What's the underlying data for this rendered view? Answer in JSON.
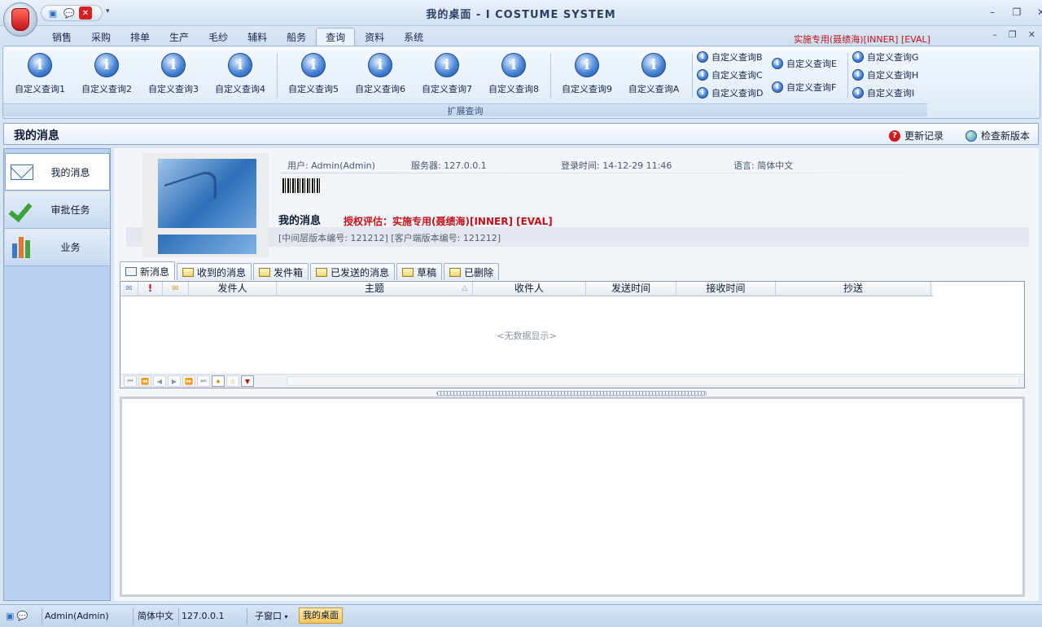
{
  "window": {
    "title": "我的桌面 - I COSTUME SYSTEM",
    "eval_label": "实施专用(聂绩海)[INNER] [EVAL]"
  },
  "menu": {
    "tabs": [
      "销售",
      "采购",
      "排单",
      "生产",
      "毛纱",
      "辅料",
      "船务",
      "查询",
      "资料",
      "系统"
    ],
    "active_tab": "查询"
  },
  "ribbon": {
    "group_caption": "扩展查询",
    "big_buttons": [
      "自定义查询1",
      "自定义查询2",
      "自定义查询3",
      "自定义查询4",
      "自定义查询5",
      "自定义查询6",
      "自定义查询7",
      "自定义查询8",
      "自定义查询9",
      "自定义查询A"
    ],
    "small_col1": [
      "自定义查询B",
      "自定义查询C",
      "自定义查询D"
    ],
    "small_col2": [
      "自定义查询E",
      "自定义查询F"
    ],
    "small_col3": [
      "自定义查询G",
      "自定义查询H",
      "自定义查询I"
    ]
  },
  "page": {
    "title": "我的消息",
    "update_log": "更新记录",
    "check_version": "检查新版本"
  },
  "sidebar": {
    "items": [
      {
        "label": "我的消息",
        "icon": "envelope-icon"
      },
      {
        "label": "审批任务",
        "icon": "checkmark-icon"
      },
      {
        "label": "业务",
        "icon": "bar-chart-icon"
      }
    ]
  },
  "info": {
    "user": "用户: Admin(Admin)",
    "server": "服务器: 127.0.0.1",
    "login_time": "登录时间: 14-12-29 11:46",
    "language": "语言:  简体中文",
    "message_title": "我的消息",
    "license": "授权评估：实施专用(聂绩海)[INNER] [EVAL]",
    "versions": "[中间层版本编号: 121212]  [客户端版本编号: 121212]"
  },
  "message_tabs": [
    "新消息",
    "收到的消息",
    "发件箱",
    "已发送的消息",
    "草稿",
    "已删除"
  ],
  "grid": {
    "columns": [
      "",
      "",
      "",
      "发件人",
      "主题",
      "收件人",
      "发送时间",
      "接收时间",
      "抄送"
    ],
    "empty_text": "<无数据显示>"
  },
  "status": {
    "user": "Admin(Admin)",
    "language": "简体中文",
    "server": "127.0.0.1",
    "child_window": "子窗口",
    "active_window": "我的桌面"
  }
}
